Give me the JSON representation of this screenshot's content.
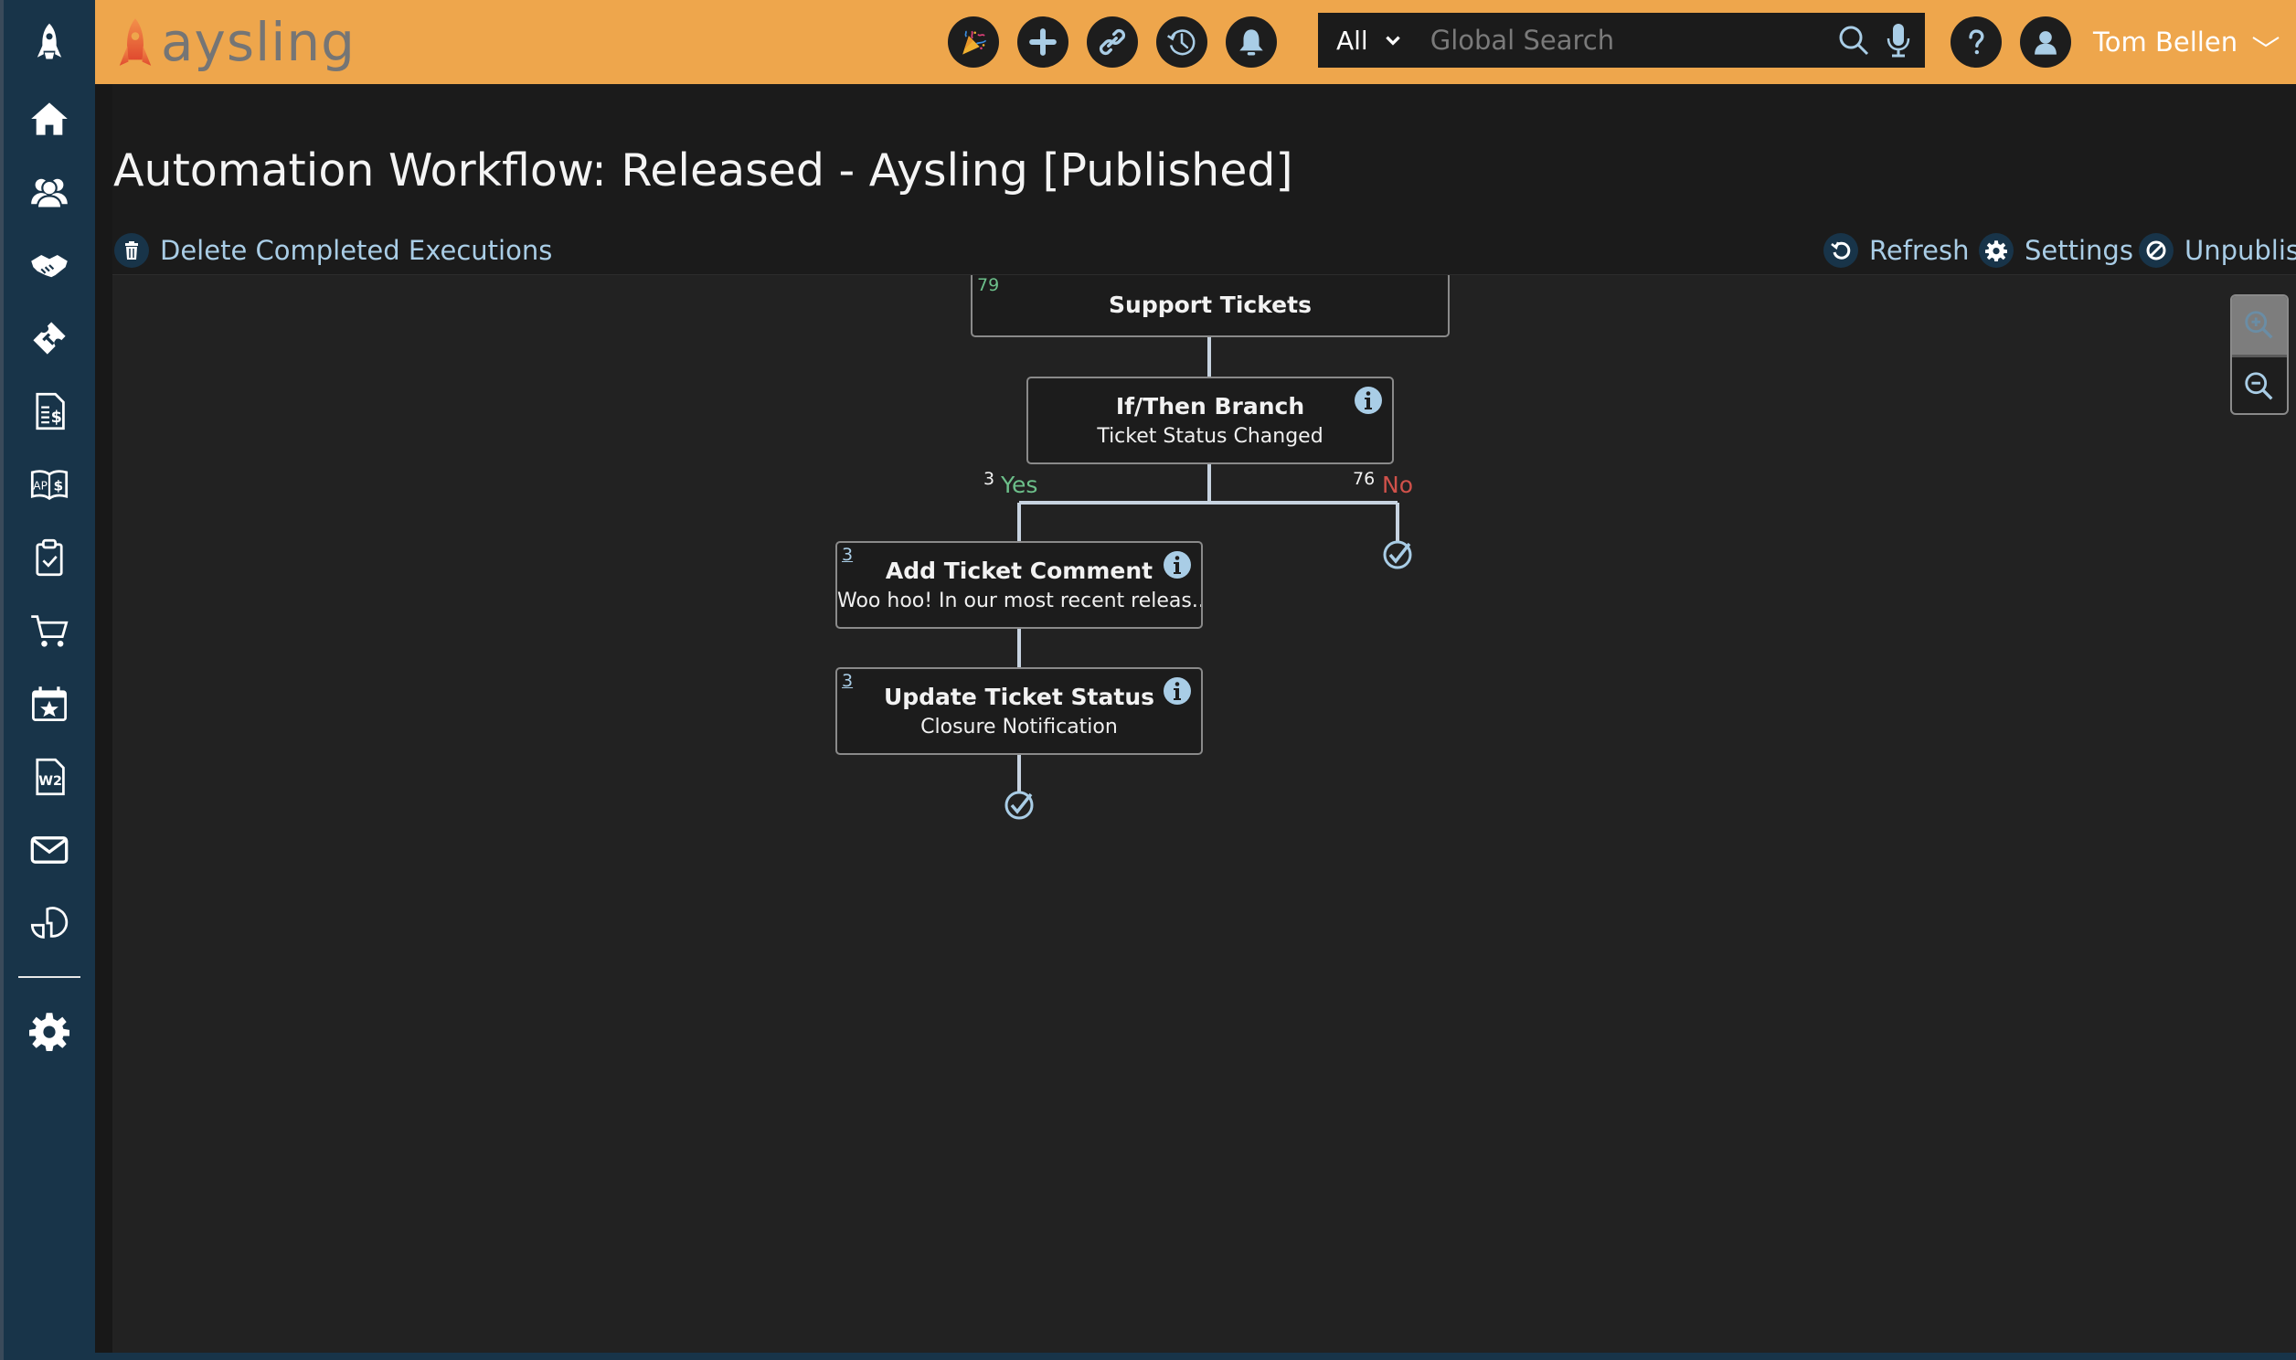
{
  "app": {
    "logo_text": "aysling",
    "colors": {
      "topbar": "#eea64c",
      "sidebar": "#183449",
      "accent_link": "#a9cde6",
      "yes_green": "#6cbf8a",
      "no_red": "#d0514a"
    }
  },
  "topbar": {
    "buttons": [
      {
        "name": "celebrate",
        "icon": "party-popper-icon"
      },
      {
        "name": "add",
        "icon": "plus-icon"
      },
      {
        "name": "links",
        "icon": "link-icon"
      },
      {
        "name": "history",
        "icon": "history-icon"
      },
      {
        "name": "notifications",
        "icon": "bell-icon"
      }
    ],
    "search": {
      "scope": "All",
      "placeholder": "Global Search",
      "value": ""
    },
    "help_icon": "help-icon",
    "user": {
      "name": "Tom Bellen",
      "avatar_icon": "user-avatar-icon"
    }
  },
  "sidebar": {
    "items": [
      {
        "id": "launch",
        "icon": "rocket-icon"
      },
      {
        "id": "home",
        "icon": "home-icon"
      },
      {
        "id": "contacts",
        "icon": "people-icon"
      },
      {
        "id": "deals",
        "icon": "handshake-icon"
      },
      {
        "id": "tickets",
        "icon": "ticket-icon"
      },
      {
        "id": "invoices",
        "icon": "invoice-icon"
      },
      {
        "id": "accounts-payable",
        "icon": "ap-book-icon"
      },
      {
        "id": "tasks",
        "icon": "clipboard-check-icon"
      },
      {
        "id": "commerce",
        "icon": "cart-icon"
      },
      {
        "id": "events",
        "icon": "calendar-star-icon"
      },
      {
        "id": "payroll",
        "icon": "w2-document-icon"
      },
      {
        "id": "email",
        "icon": "envelope-icon"
      },
      {
        "id": "reports",
        "icon": "pie-chart-icon"
      },
      {
        "id": "settings",
        "icon": "gear-icon"
      }
    ]
  },
  "page": {
    "title": "Automation Workflow: Released - Aysling [Published]",
    "actions_left": [
      {
        "label": "Delete Completed Executions",
        "icon": "trash-icon"
      }
    ],
    "actions_right": [
      {
        "label": "Refresh",
        "icon": "refresh-icon"
      },
      {
        "label": "Settings",
        "icon": "gear-icon"
      },
      {
        "label": "Unpublish",
        "icon": "ban-icon"
      }
    ]
  },
  "workflow": {
    "trigger": {
      "title": "Support Tickets",
      "count": "79"
    },
    "branch": {
      "title": "If/Then Branch",
      "subtitle": "Ticket Status Changed",
      "yes_label": "Yes",
      "yes_count": "3",
      "no_label": "No",
      "no_count": "76"
    },
    "steps": [
      {
        "title": "Add Ticket Comment",
        "subtitle": "Woo hoo! In our most recent releas...",
        "count": "3"
      },
      {
        "title": "Update Ticket Status",
        "subtitle": "Closure Notification",
        "count": "3"
      }
    ],
    "end_icons": [
      "check-circle-icon",
      "check-circle-icon"
    ]
  },
  "zoom_controls": {
    "zoom_in_enabled": false,
    "zoom_out_enabled": true
  }
}
